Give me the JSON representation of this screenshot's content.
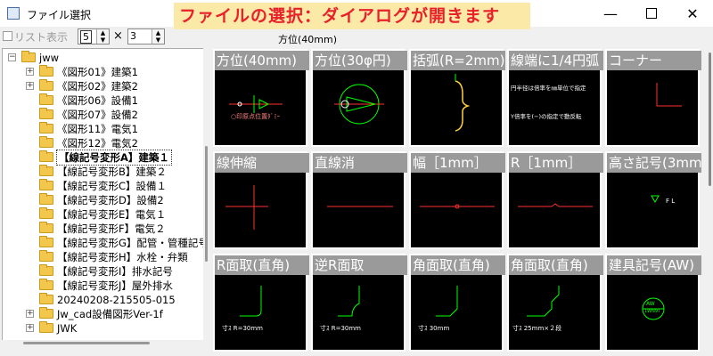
{
  "window": {
    "title": "ファイル選択",
    "minimize_icon": "minimize-icon",
    "maximize_icon": "maximize-icon",
    "close_icon": "close-icon"
  },
  "banner": {
    "text": "ファイルの選択：ダイアログが開きます",
    "bg_color": "#fbe9a7",
    "text_color": "#e8202a"
  },
  "toolbar": {
    "list_display_label": "リスト表示",
    "columns_value": "5",
    "times": "×",
    "rows_value": "3",
    "preview_title": "方位(40mm)"
  },
  "tree": {
    "items": [
      {
        "label": "jww",
        "expander": "−"
      },
      {
        "label": "《図形01》建築1",
        "expander": "+"
      },
      {
        "label": "《図形02》建築2",
        "expander": "+"
      },
      {
        "label": "《図形06》設備1",
        "expander": ""
      },
      {
        "label": "《図形07》設備2",
        "expander": ""
      },
      {
        "label": "《図形11》電気1",
        "expander": ""
      },
      {
        "label": "《図形12》電気2",
        "expander": ""
      },
      {
        "label": "【線記号変形A】建築１",
        "expander": ""
      },
      {
        "label": "【線記号変形B】建築２",
        "expander": ""
      },
      {
        "label": "【線記号変形C】設備１",
        "expander": ""
      },
      {
        "label": "【線記号変形D】設備2",
        "expander": ""
      },
      {
        "label": "【線記号変形E】電気１",
        "expander": ""
      },
      {
        "label": "【線記号変形F】電気２",
        "expander": ""
      },
      {
        "label": "【線記号変形G】配管・管種記号",
        "expander": ""
      },
      {
        "label": "【線記号変形H】水栓・弁類",
        "expander": ""
      },
      {
        "label": "【線記号変形I】排水記号",
        "expander": ""
      },
      {
        "label": "【線記号変形J】屋外排水",
        "expander": ""
      },
      {
        "label": "20240208-215505-015",
        "expander": ""
      },
      {
        "label": "Jw_cad設備図形Ver-1f",
        "expander": "+"
      },
      {
        "label": "JWK",
        "expander": "+"
      }
    ]
  },
  "grid": {
    "cells": [
      {
        "caption": "方位(40mm)",
        "notes": [
          "○印原点位置ﾀﾞﾐｰ"
        ]
      },
      {
        "caption": "方位(30φ円)",
        "notes": []
      },
      {
        "caption": "括弧(R=2mm)",
        "notes": []
      },
      {
        "caption": "線端に1/4円弧",
        "notes": [
          "円半径は倍率を㎜単位で指定",
          "Y倍率を(−)の指定で動反転"
        ]
      },
      {
        "caption": "コーナー",
        "notes": []
      },
      {
        "caption": "線伸縮",
        "notes": []
      },
      {
        "caption": "直線消",
        "notes": []
      },
      {
        "caption": "幅［1mm］",
        "notes": []
      },
      {
        "caption": "R［1mm］",
        "notes": []
      },
      {
        "caption": "高さ記号(3mm)",
        "notes": [
          "F L"
        ]
      },
      {
        "caption": "R面取(直角)",
        "notes": [
          "寸ｽ R=30mm"
        ]
      },
      {
        "caption": "逆R面取",
        "notes": [
          "寸ｽ R=30mm"
        ]
      },
      {
        "caption": "角面取(直角)",
        "notes": [
          "寸ｽ 30mm"
        ]
      },
      {
        "caption": "角面取(直角)",
        "notes": [
          "寸ｽ 25mm×２段"
        ]
      },
      {
        "caption": "建具記号(AW)",
        "notes": [
          "AW",
          "1WN9T"
        ]
      }
    ]
  }
}
